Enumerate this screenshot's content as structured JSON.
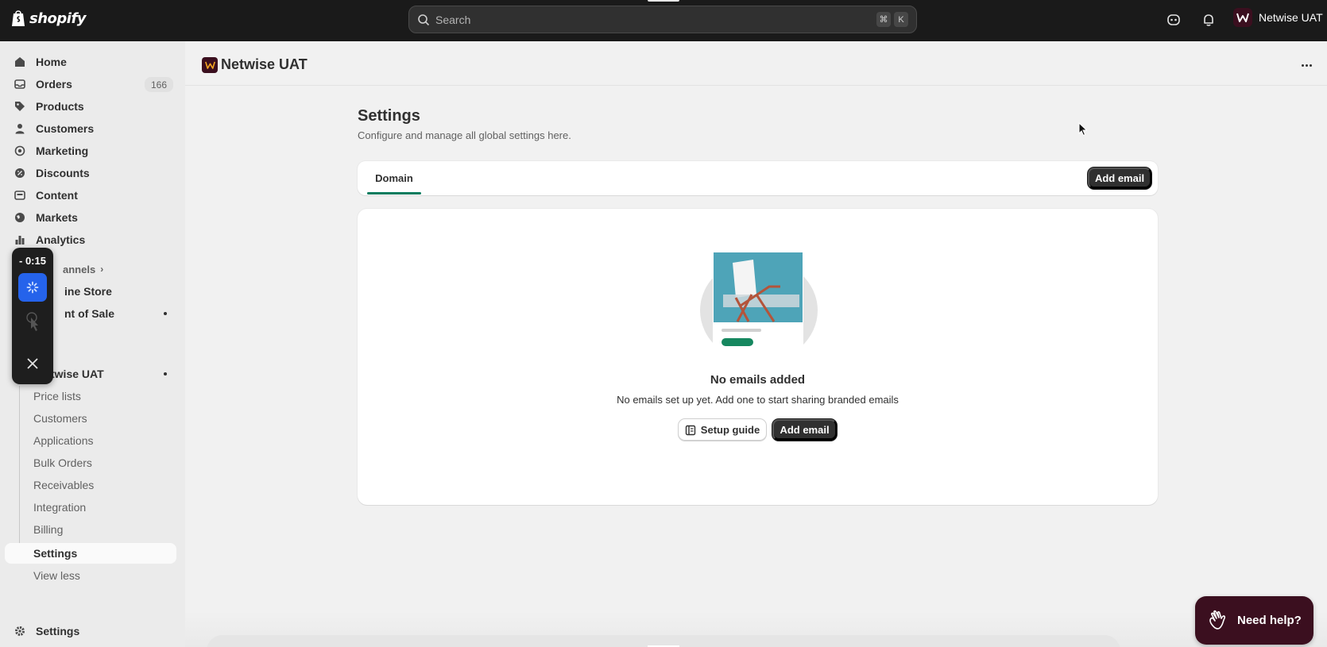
{
  "topbar": {
    "logo_text": "shopify",
    "search_placeholder": "Search",
    "shortcut_keys": [
      "⌘",
      "K"
    ],
    "store_name": "Netwise UAT"
  },
  "sidebar": {
    "main_items": [
      {
        "label": "Home",
        "icon": "home-icon"
      },
      {
        "label": "Orders",
        "icon": "inbox-icon",
        "badge": "166"
      },
      {
        "label": "Products",
        "icon": "tag-icon"
      },
      {
        "label": "Customers",
        "icon": "person-icon"
      },
      {
        "label": "Marketing",
        "icon": "target-icon"
      },
      {
        "label": "Discounts",
        "icon": "discount-icon"
      },
      {
        "label": "Content",
        "icon": "content-icon"
      },
      {
        "label": "Markets",
        "icon": "globe-icon"
      },
      {
        "label": "Analytics",
        "icon": "bar-chart-icon"
      }
    ],
    "channels_label": "annels",
    "channel_items": [
      {
        "label": "ine Store"
      },
      {
        "label": "nt of Sale"
      }
    ],
    "app_label": "twise UAT",
    "app_sub_items": [
      {
        "label": "Price lists"
      },
      {
        "label": "Customers"
      },
      {
        "label": "Applications"
      },
      {
        "label": "Bulk Orders"
      },
      {
        "label": "Receivables"
      },
      {
        "label": "Integration"
      },
      {
        "label": "Billing"
      },
      {
        "label": "Settings",
        "active": true
      },
      {
        "label": "View less"
      }
    ],
    "footer_settings": "Settings"
  },
  "recorder": {
    "time": "- 0:15"
  },
  "header": {
    "app_title": "Netwise UAT"
  },
  "settings": {
    "title": "Settings",
    "subtitle": "Configure and manage all global settings here.",
    "tab_label": "Domain",
    "add_email_label": "Add email"
  },
  "empty_state": {
    "title": "No emails added",
    "description": "No emails set up yet. Add one to start sharing branded emails",
    "setup_guide_label": "Setup guide",
    "add_email_label": "Add email"
  },
  "help": {
    "label": "Need help?"
  },
  "colors": {
    "topbar_bg": "#1a1a1a",
    "brand_maroon": "#3b0f1f",
    "tab_accent": "#047b5d",
    "recorder_blue": "#2563eb"
  }
}
